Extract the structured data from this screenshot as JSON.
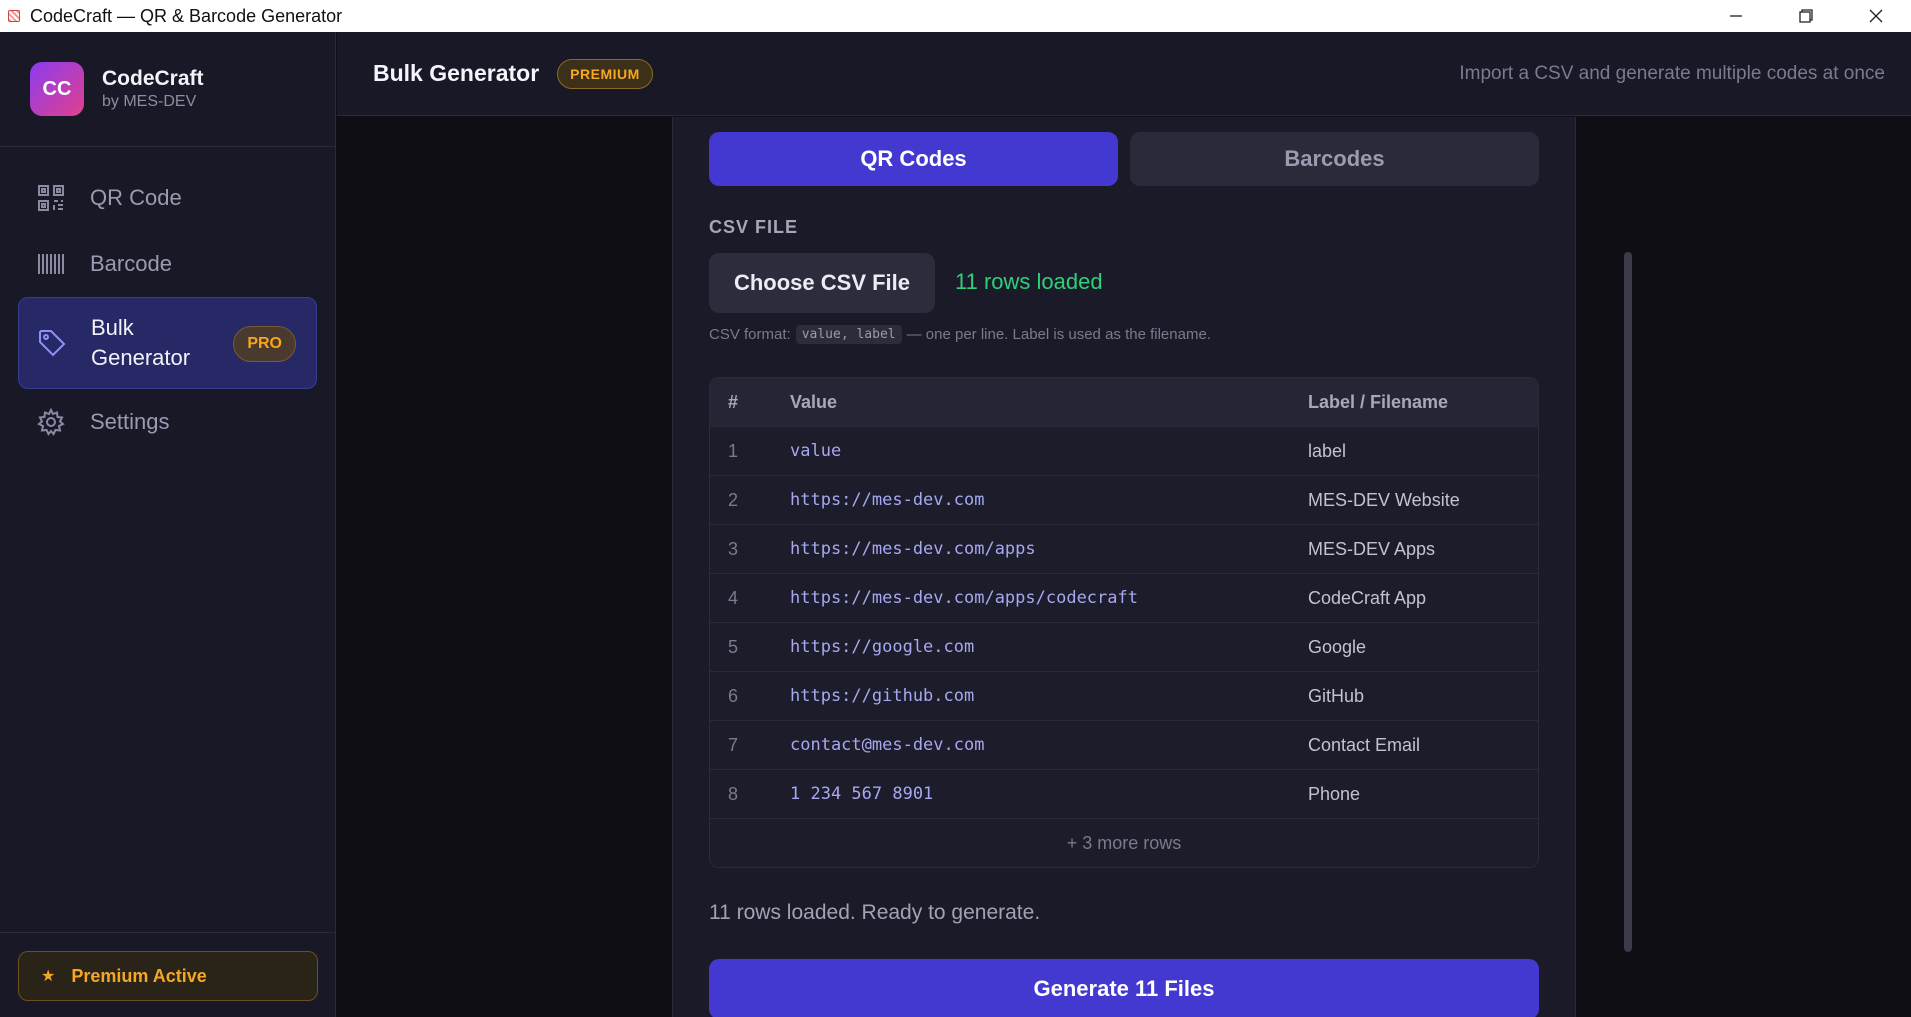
{
  "window": {
    "title": "CodeCraft — QR & Barcode Generator"
  },
  "brand": {
    "logo": "CC",
    "name": "CodeCraft",
    "sub": "by MES-DEV"
  },
  "sidebar": {
    "items": [
      {
        "label": "QR Code",
        "icon": "qr-code-icon"
      },
      {
        "label": "Barcode",
        "icon": "barcode-icon"
      },
      {
        "label": "Bulk Generator",
        "icon": "tag-icon",
        "badge": "PRO",
        "active": true
      },
      {
        "label": "Settings",
        "icon": "gear-icon"
      }
    ],
    "footer": {
      "label": "Premium Active",
      "star": "★"
    }
  },
  "header": {
    "title": "Bulk Generator",
    "badge": "PREMIUM",
    "description": "Import a CSV and generate multiple codes at once"
  },
  "tabs": [
    {
      "label": "QR Codes",
      "active": true
    },
    {
      "label": "Barcodes",
      "active": false
    }
  ],
  "csv": {
    "section_label": "CSV FILE",
    "choose_label": "Choose CSV File",
    "status": "11 rows loaded",
    "hint_prefix": "CSV format:",
    "hint_code": "value, label",
    "hint_suffix": "— one per line. Label is used as the filename."
  },
  "table": {
    "headers": {
      "num": "#",
      "value": "Value",
      "label": "Label / Filename"
    },
    "rows": [
      {
        "num": "1",
        "value": "value",
        "label": "label"
      },
      {
        "num": "2",
        "value": "https://mes-dev.com",
        "label": "MES-DEV Website"
      },
      {
        "num": "3",
        "value": "https://mes-dev.com/apps",
        "label": "MES-DEV Apps"
      },
      {
        "num": "4",
        "value": "https://mes-dev.com/apps/codecraft",
        "label": "CodeCraft App"
      },
      {
        "num": "5",
        "value": "https://google.com",
        "label": "Google"
      },
      {
        "num": "6",
        "value": "https://github.com",
        "label": "GitHub"
      },
      {
        "num": "7",
        "value": "contact@mes-dev.com",
        "label": "Contact Email"
      },
      {
        "num": "8",
        "value": "1 234 567 8901",
        "label": "Phone"
      }
    ],
    "more": "+ 3 more rows"
  },
  "ready_text": "11 rows loaded. Ready to generate.",
  "generate_label": "Generate 11 Files",
  "colors": {
    "accent": "#4338d0",
    "success": "#2fd07a",
    "premium": "#f5a623"
  }
}
